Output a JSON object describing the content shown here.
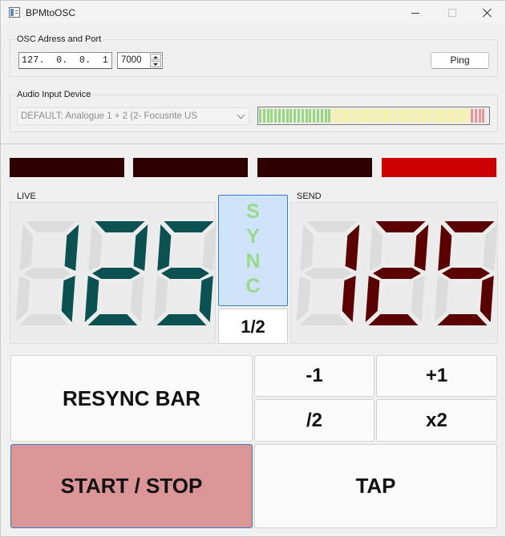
{
  "window": {
    "title": "BPMtoOSC"
  },
  "osc": {
    "group_title": "OSC Adress and Port",
    "ip_value": "127.  0.  0.  1",
    "port_value": "7000",
    "ping_label": "Ping"
  },
  "audio": {
    "group_title": "Audio Input Device",
    "device_value": "DEFAULT: Analogue 1 + 2 (2- Focusrite US",
    "level_meter": {
      "green_segments": 19,
      "yellow_segments": 36,
      "red_segments": 4,
      "colors": {
        "green": "#98d67f",
        "yellow": "#f8f49a",
        "red": "#e8959a",
        "empty": "#ececec"
      }
    }
  },
  "beat_indicators": [
    {
      "active": false,
      "color": "#2f0000"
    },
    {
      "active": false,
      "color": "#2f0000"
    },
    {
      "active": false,
      "color": "#2f0000"
    },
    {
      "active": true,
      "color": "#cc0000"
    }
  ],
  "live": {
    "title": "LIVE",
    "bpm": "125",
    "color": "#0b5151"
  },
  "send": {
    "title": "SEND",
    "bpm": "125",
    "color": "#5a0000"
  },
  "lcd_off_color": "#dcdcdc",
  "sync": {
    "letters": [
      "S",
      "Y",
      "N",
      "C"
    ]
  },
  "ratio": {
    "value": "1/2"
  },
  "buttons": {
    "resync_bar": "RESYNC BAR",
    "minus_one": "-1",
    "plus_one": "+1",
    "half": "/2",
    "double": "x2",
    "start_stop": "START / STOP",
    "tap": "TAP"
  },
  "colors": {
    "start_stop_bg": "#dc9597",
    "accent_border": "#3a7cc7",
    "sync_bg": "#cfe4fa",
    "sync_text": "#9ad88a"
  }
}
